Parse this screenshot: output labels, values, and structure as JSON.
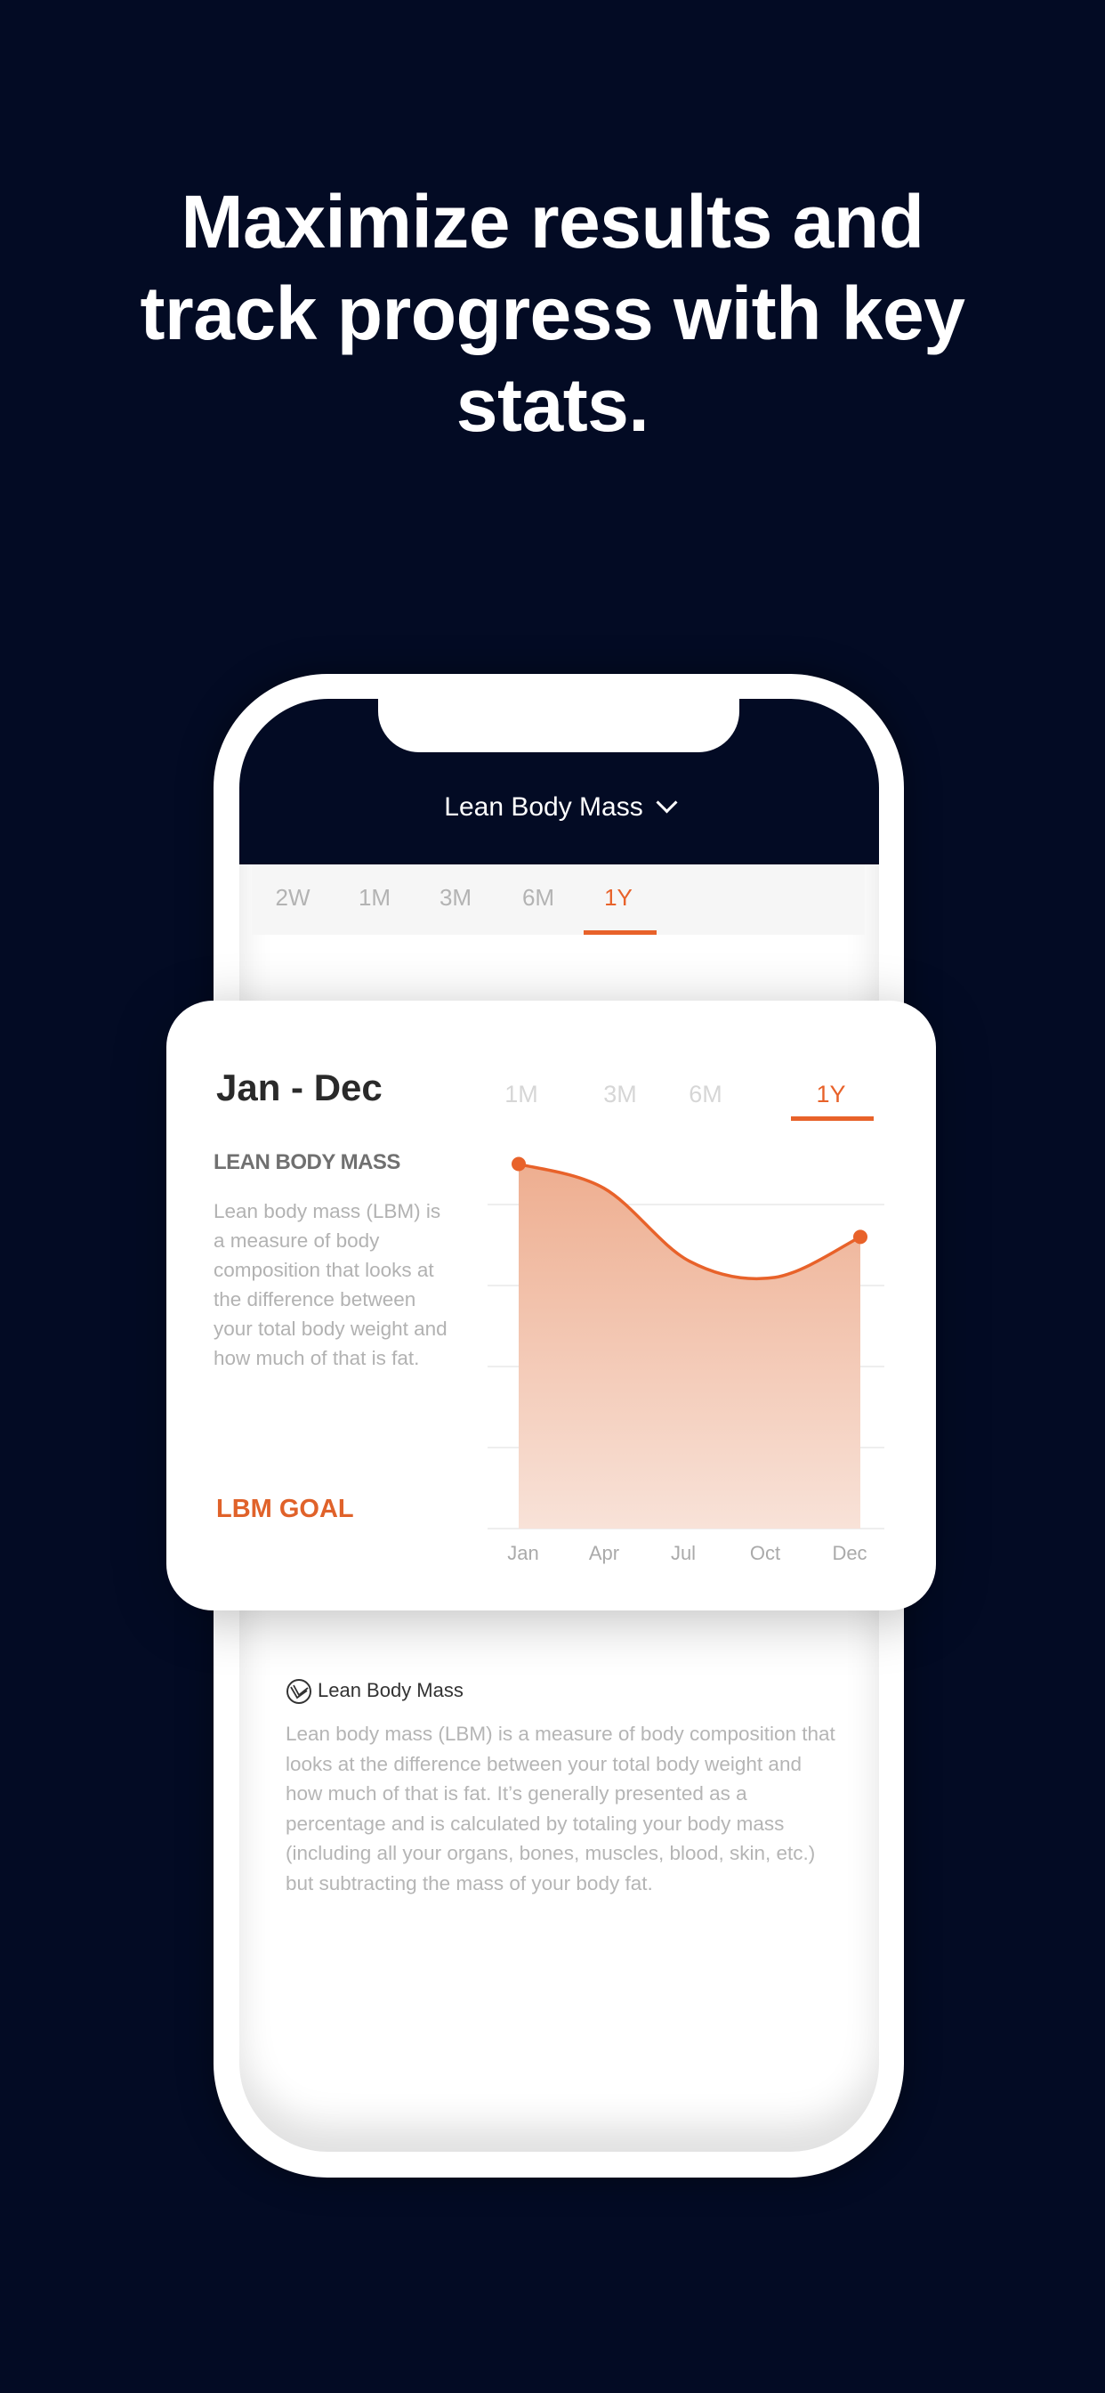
{
  "headline": [
    "Maximize results and",
    "track progress with key",
    "stats."
  ],
  "app": {
    "title": "Lean Body Mass",
    "title_icon": "chevron-down-icon",
    "tabs": [
      "2W",
      "1M",
      "3M",
      "6M",
      "1Y"
    ],
    "active_tab": "1Y"
  },
  "card": {
    "title": "Jan - Dec",
    "tabs": [
      "1M",
      "3M",
      "6M",
      "1Y"
    ],
    "active_tab": "1Y",
    "subtitle": "LEAN BODY MASS",
    "description": "Lean body mass (LBM) is a measure of body composition that looks at the difference between your total body weight and how much of that is fat.",
    "goal_label": "LBM GOAL"
  },
  "info": {
    "icon": "lean-body-mass-logo-icon",
    "title": "Lean Body Mass",
    "text": "Lean body mass (LBM) is a measure of body composition that looks at the difference between your total body weight and how much of that is fat. It’s generally presented as a percentage and is calculated by totaling your body mass (including all your organs, bones, muscles, blood, skin, etc.) but subtracting the mass of your body fat."
  },
  "colors": {
    "background": "#030b24",
    "accent": "#e8622a",
    "fill_top": "#eeae90",
    "fill_bottom": "#f8e2d8"
  },
  "chart_data": {
    "type": "area",
    "x_tick_labels": [
      "Jan",
      "Apr",
      "Jul",
      "Oct",
      "Dec"
    ],
    "x": [
      "Jan",
      "Apr",
      "Jul",
      "Oct",
      "Dec"
    ],
    "values": [
      4.5,
      4.2,
      3.3,
      3.1,
      3.6
    ],
    "markers_on": [
      "Jan",
      "Dec"
    ],
    "ylim": [
      0,
      4.5
    ],
    "y_tick_labels_shown": false,
    "grid": true,
    "note_units": "relative (no y-axis labels shown)"
  }
}
